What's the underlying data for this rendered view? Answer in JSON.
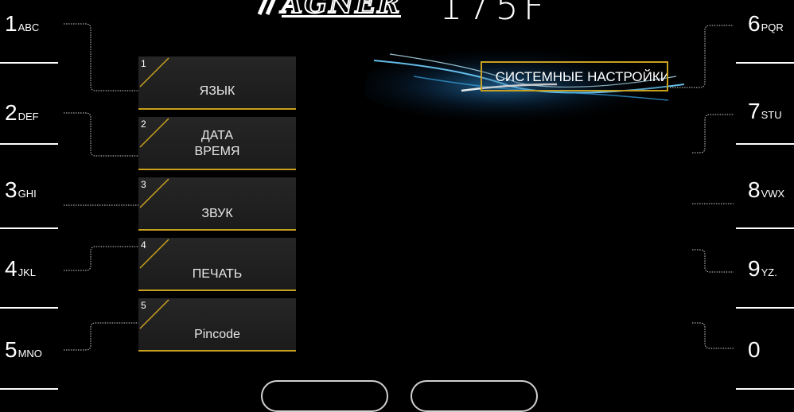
{
  "header": {
    "brand": "MAGNER",
    "model": "175F"
  },
  "screen_title": "СИСТЕМНЫЕ НАСТРОЙКИ",
  "left_keys": [
    {
      "num": "1",
      "letters": "ABC"
    },
    {
      "num": "2",
      "letters": "DEF"
    },
    {
      "num": "3",
      "letters": "GHI"
    },
    {
      "num": "4",
      "letters": "JKL"
    },
    {
      "num": "5",
      "letters": "MNO"
    }
  ],
  "right_keys": [
    {
      "num": "6",
      "letters": "PQR"
    },
    {
      "num": "7",
      "letters": "STU"
    },
    {
      "num": "8",
      "letters": "VWX"
    },
    {
      "num": "9",
      "letters": "YZ."
    },
    {
      "num": "0",
      "letters": ""
    }
  ],
  "menu": [
    {
      "index": "1",
      "label": "ЯЗЫК"
    },
    {
      "index": "2",
      "label": "ДАТА\nВРЕМЯ"
    },
    {
      "index": "3",
      "label": "ЗВУК"
    },
    {
      "index": "4",
      "label": "ПЕЧАТЬ"
    },
    {
      "index": "5",
      "label": "Pincode"
    }
  ],
  "colors": {
    "accent": "#c8a020",
    "background": "#000000",
    "button": "#222222"
  }
}
